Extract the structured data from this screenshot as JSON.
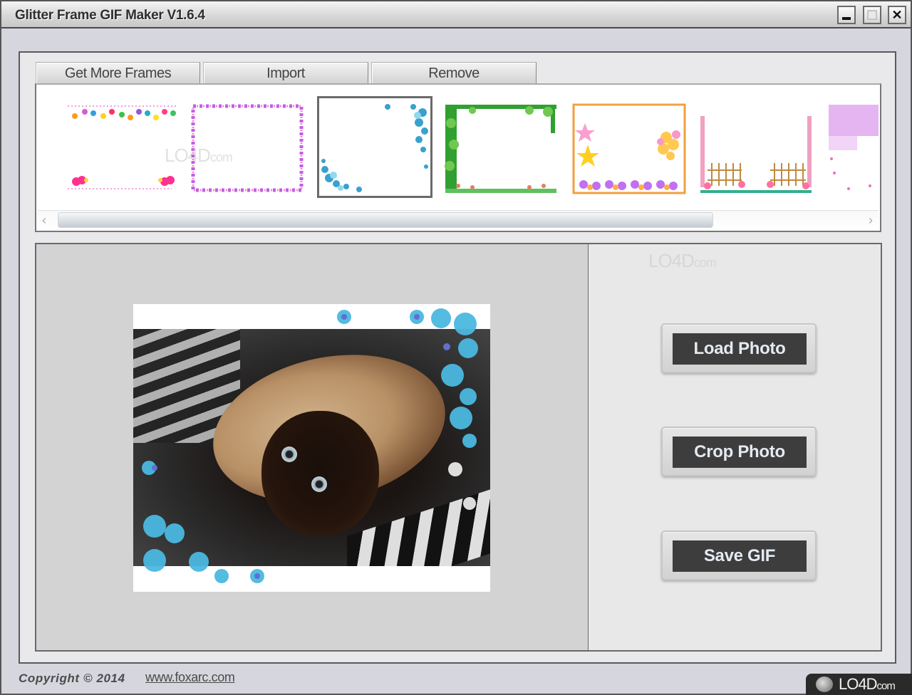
{
  "window": {
    "title": "Glitter Frame GIF Maker V1.6.4",
    "controls": {
      "minimize": "minimize-icon",
      "maximize": "maximize-icon",
      "close": "close-icon",
      "close_glyph": "✕"
    }
  },
  "toolbar": {
    "tabs": [
      {
        "label": "Get More Frames"
      },
      {
        "label": "Import"
      },
      {
        "label": "Remove"
      }
    ]
  },
  "frames": {
    "items": [
      {
        "name": "hanging-hearts-frame",
        "selected": false
      },
      {
        "name": "purple-diamond-border-frame",
        "selected": false
      },
      {
        "name": "blue-flowers-corner-frame",
        "selected": true
      },
      {
        "name": "green-vines-frame",
        "selected": false
      },
      {
        "name": "stars-balloons-frame",
        "selected": false
      },
      {
        "name": "garden-fence-frame",
        "selected": false
      },
      {
        "name": "pink-sparkle-frame",
        "selected": false
      }
    ],
    "scroll": {
      "left_arrow": "‹",
      "right_arrow": "›",
      "position_fraction": 0.0,
      "visible_fraction": 0.78
    }
  },
  "preview": {
    "image": "cat-photo-with-blue-flower-frame"
  },
  "actions": {
    "load_photo": "Load Photo",
    "crop_photo": "Crop Photo",
    "save_gif": "Save GIF"
  },
  "footer": {
    "copyright": "Copyright © 2014",
    "link": "www.foxarc.com"
  },
  "watermark": {
    "text": "LO4D",
    "suffix": "com"
  },
  "colors": {
    "action_button_bg": "#3d3d3d",
    "action_button_text": "#e4eaf2",
    "preview_bg": "#d3d3d3",
    "panel_bg": "#e9e9eb"
  }
}
